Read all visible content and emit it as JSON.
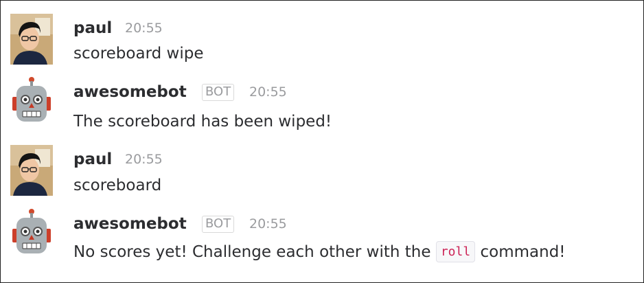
{
  "messages": [
    {
      "author": "paul",
      "is_bot": false,
      "bot_tag": "",
      "time": "20:55",
      "text": "scoreboard wipe",
      "avatar": "user-photo-avatar"
    },
    {
      "author": "awesomebot",
      "is_bot": true,
      "bot_tag": "BOT",
      "time": "20:55",
      "text": "The scoreboard has been wiped!",
      "avatar": "robot-avatar"
    },
    {
      "author": "paul",
      "is_bot": false,
      "bot_tag": "",
      "time": "20:55",
      "text": "scoreboard",
      "avatar": "user-photo-avatar"
    },
    {
      "author": "awesomebot",
      "is_bot": true,
      "bot_tag": "BOT",
      "time": "20:55",
      "text_before": "No scores yet! Challenge each other with the",
      "code": "roll",
      "text_after": "command!",
      "avatar": "robot-avatar"
    }
  ]
}
